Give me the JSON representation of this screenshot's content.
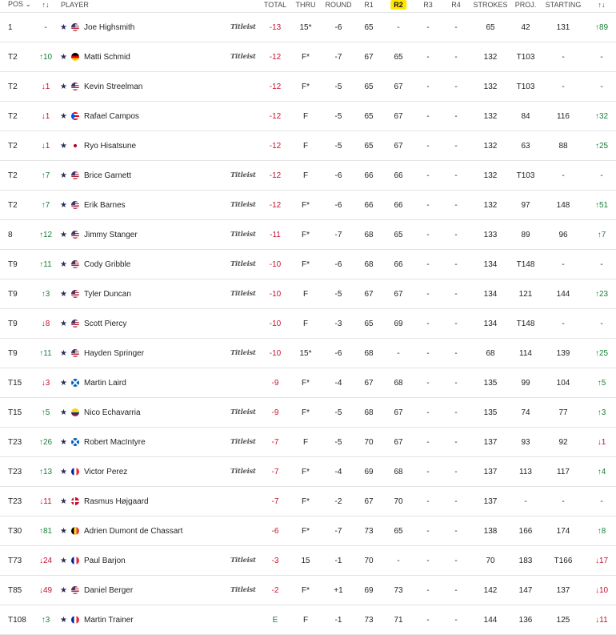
{
  "header": {
    "pos": "POS ⌄",
    "move": "↑↓",
    "player": "PLAYER",
    "total": "TOTAL",
    "thru": "THRU",
    "round": "ROUND",
    "r1": "R1",
    "r2": "R2",
    "r3": "R3",
    "r4": "R4",
    "strokes": "STROKES",
    "proj": "PROJ.",
    "starting": "STARTING",
    "change": "↑↓"
  },
  "brand_text": "Titleist",
  "colors": {
    "negative": "#c8102e",
    "positive": "#1a7f37",
    "r2_highlight": "#ffe500"
  },
  "rows": [
    {
      "pos": "1",
      "move": "-",
      "dir": "none",
      "country": "USA",
      "player": "Joe Highsmith",
      "brand": true,
      "total": "-13",
      "thru": "15*",
      "round": "-6",
      "r1": "65",
      "r2": "-",
      "r3": "-",
      "r4": "-",
      "strokes": "65",
      "proj": "42",
      "starting": "131",
      "change": "↑89",
      "cdir": "up"
    },
    {
      "pos": "T2",
      "move": "↑10",
      "dir": "up",
      "country": "GER",
      "player": "Matti Schmid",
      "brand": true,
      "total": "-12",
      "thru": "F*",
      "round": "-7",
      "r1": "67",
      "r2": "65",
      "r3": "-",
      "r4": "-",
      "strokes": "132",
      "proj": "T103",
      "starting": "-",
      "change": "-",
      "cdir": "none"
    },
    {
      "pos": "T2",
      "move": "↓1",
      "dir": "down",
      "country": "USA",
      "player": "Kevin Streelman",
      "brand": false,
      "total": "-12",
      "thru": "F*",
      "round": "-5",
      "r1": "65",
      "r2": "67",
      "r3": "-",
      "r4": "-",
      "strokes": "132",
      "proj": "T103",
      "starting": "-",
      "change": "-",
      "cdir": "none"
    },
    {
      "pos": "T2",
      "move": "↓1",
      "dir": "down",
      "country": "PUR",
      "player": "Rafael Campos",
      "brand": false,
      "total": "-12",
      "thru": "F",
      "round": "-5",
      "r1": "65",
      "r2": "67",
      "r3": "-",
      "r4": "-",
      "strokes": "132",
      "proj": "84",
      "starting": "116",
      "change": "↑32",
      "cdir": "up"
    },
    {
      "pos": "T2",
      "move": "↓1",
      "dir": "down",
      "country": "JPN",
      "player": "Ryo Hisatsune",
      "brand": false,
      "total": "-12",
      "thru": "F",
      "round": "-5",
      "r1": "65",
      "r2": "67",
      "r3": "-",
      "r4": "-",
      "strokes": "132",
      "proj": "63",
      "starting": "88",
      "change": "↑25",
      "cdir": "up"
    },
    {
      "pos": "T2",
      "move": "↑7",
      "dir": "up",
      "country": "USA",
      "player": "Brice Garnett",
      "brand": true,
      "total": "-12",
      "thru": "F",
      "round": "-6",
      "r1": "66",
      "r2": "66",
      "r3": "-",
      "r4": "-",
      "strokes": "132",
      "proj": "T103",
      "starting": "-",
      "change": "-",
      "cdir": "none"
    },
    {
      "pos": "T2",
      "move": "↑7",
      "dir": "up",
      "country": "USA",
      "player": "Erik Barnes",
      "brand": true,
      "total": "-12",
      "thru": "F*",
      "round": "-6",
      "r1": "66",
      "r2": "66",
      "r3": "-",
      "r4": "-",
      "strokes": "132",
      "proj": "97",
      "starting": "148",
      "change": "↑51",
      "cdir": "up"
    },
    {
      "pos": "8",
      "move": "↑12",
      "dir": "up",
      "country": "USA",
      "player": "Jimmy Stanger",
      "brand": true,
      "total": "-11",
      "thru": "F*",
      "round": "-7",
      "r1": "68",
      "r2": "65",
      "r3": "-",
      "r4": "-",
      "strokes": "133",
      "proj": "89",
      "starting": "96",
      "change": "↑7",
      "cdir": "up"
    },
    {
      "pos": "T9",
      "move": "↑11",
      "dir": "up",
      "country": "USA",
      "player": "Cody Gribble",
      "brand": true,
      "total": "-10",
      "thru": "F*",
      "round": "-6",
      "r1": "68",
      "r2": "66",
      "r3": "-",
      "r4": "-",
      "strokes": "134",
      "proj": "T148",
      "starting": "-",
      "change": "-",
      "cdir": "none"
    },
    {
      "pos": "T9",
      "move": "↑3",
      "dir": "up",
      "country": "USA",
      "player": "Tyler Duncan",
      "brand": true,
      "total": "-10",
      "thru": "F",
      "round": "-5",
      "r1": "67",
      "r2": "67",
      "r3": "-",
      "r4": "-",
      "strokes": "134",
      "proj": "121",
      "starting": "144",
      "change": "↑23",
      "cdir": "up"
    },
    {
      "pos": "T9",
      "move": "↓8",
      "dir": "down",
      "country": "USA",
      "player": "Scott Piercy",
      "brand": false,
      "total": "-10",
      "thru": "F",
      "round": "-3",
      "r1": "65",
      "r2": "69",
      "r3": "-",
      "r4": "-",
      "strokes": "134",
      "proj": "T148",
      "starting": "-",
      "change": "-",
      "cdir": "none"
    },
    {
      "pos": "T9",
      "move": "↑11",
      "dir": "up",
      "country": "USA",
      "player": "Hayden Springer",
      "brand": true,
      "total": "-10",
      "thru": "15*",
      "round": "-6",
      "r1": "68",
      "r2": "-",
      "r3": "-",
      "r4": "-",
      "strokes": "68",
      "proj": "114",
      "starting": "139",
      "change": "↑25",
      "cdir": "up"
    },
    {
      "pos": "T15",
      "move": "↓3",
      "dir": "down",
      "country": "SCO",
      "player": "Martin Laird",
      "brand": false,
      "total": "-9",
      "thru": "F*",
      "round": "-4",
      "r1": "67",
      "r2": "68",
      "r3": "-",
      "r4": "-",
      "strokes": "135",
      "proj": "99",
      "starting": "104",
      "change": "↑5",
      "cdir": "up"
    },
    {
      "pos": "T15",
      "move": "↑5",
      "dir": "up",
      "country": "COL",
      "player": "Nico Echavarria",
      "brand": true,
      "total": "-9",
      "thru": "F*",
      "round": "-5",
      "r1": "68",
      "r2": "67",
      "r3": "-",
      "r4": "-",
      "strokes": "135",
      "proj": "74",
      "starting": "77",
      "change": "↑3",
      "cdir": "up"
    },
    {
      "pos": "T23",
      "move": "↑26",
      "dir": "up",
      "country": "SCO",
      "player": "Robert MacIntyre",
      "brand": true,
      "total": "-7",
      "thru": "F",
      "round": "-5",
      "r1": "70",
      "r2": "67",
      "r3": "-",
      "r4": "-",
      "strokes": "137",
      "proj": "93",
      "starting": "92",
      "change": "↓1",
      "cdir": "down"
    },
    {
      "pos": "T23",
      "move": "↑13",
      "dir": "up",
      "country": "FRA",
      "player": "Victor Perez",
      "brand": true,
      "total": "-7",
      "thru": "F*",
      "round": "-4",
      "r1": "69",
      "r2": "68",
      "r3": "-",
      "r4": "-",
      "strokes": "137",
      "proj": "113",
      "starting": "117",
      "change": "↑4",
      "cdir": "up"
    },
    {
      "pos": "T23",
      "move": "↓11",
      "dir": "down",
      "country": "DEN",
      "player": "Rasmus Højgaard",
      "brand": false,
      "total": "-7",
      "thru": "F*",
      "round": "-2",
      "r1": "67",
      "r2": "70",
      "r3": "-",
      "r4": "-",
      "strokes": "137",
      "proj": "-",
      "starting": "-",
      "change": "-",
      "cdir": "none"
    },
    {
      "pos": "T30",
      "move": "↑81",
      "dir": "up",
      "country": "BEL",
      "player": "Adrien Dumont de Chassart",
      "brand": false,
      "total": "-6",
      "thru": "F*",
      "round": "-7",
      "r1": "73",
      "r2": "65",
      "r3": "-",
      "r4": "-",
      "strokes": "138",
      "proj": "166",
      "starting": "174",
      "change": "↑8",
      "cdir": "up"
    },
    {
      "pos": "T73",
      "move": "↓24",
      "dir": "down",
      "country": "FRA",
      "player": "Paul Barjon",
      "brand": true,
      "total": "-3",
      "thru": "15",
      "round": "-1",
      "r1": "70",
      "r2": "-",
      "r3": "-",
      "r4": "-",
      "strokes": "70",
      "proj": "183",
      "starting": "T166",
      "change": "↓17",
      "cdir": "down"
    },
    {
      "pos": "T85",
      "move": "↓49",
      "dir": "down",
      "country": "USA",
      "player": "Daniel Berger",
      "brand": true,
      "total": "-2",
      "thru": "F*",
      "round": "+1",
      "r1": "69",
      "r2": "73",
      "r3": "-",
      "r4": "-",
      "strokes": "142",
      "proj": "147",
      "starting": "137",
      "change": "↓10",
      "cdir": "down"
    },
    {
      "pos": "T108",
      "move": "↑3",
      "dir": "up",
      "country": "FRA",
      "player": "Martin Trainer",
      "brand": false,
      "total": "E",
      "thru": "F",
      "round": "-1",
      "r1": "73",
      "r2": "71",
      "r3": "-",
      "r4": "-",
      "strokes": "144",
      "proj": "136",
      "starting": "125",
      "change": "↓11",
      "cdir": "down"
    }
  ]
}
